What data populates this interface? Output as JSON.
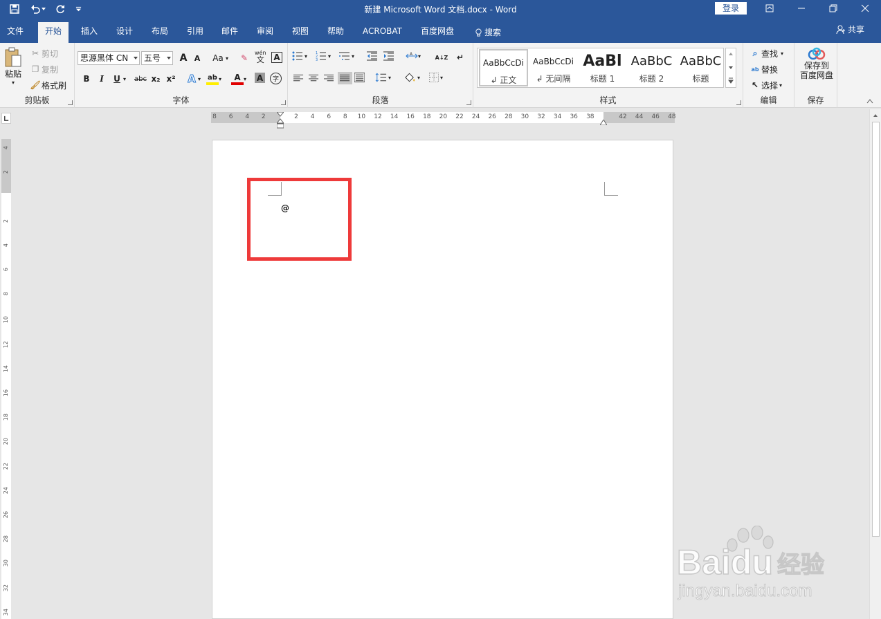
{
  "titlebar": {
    "title": "新建 Microsoft Word 文档.docx  -  Word",
    "login_label": "登录"
  },
  "tabs": [
    "文件",
    "开始",
    "插入",
    "设计",
    "布局",
    "引用",
    "邮件",
    "审阅",
    "视图",
    "帮助",
    "ACROBAT",
    "百度网盘",
    "搜索"
  ],
  "share_label": "共享",
  "clipboard": {
    "paste": "粘贴",
    "cut": "剪切",
    "copy": "复制",
    "format_painter": "格式刷",
    "group": "剪贴板"
  },
  "font": {
    "name": "思源黑体 CN",
    "size": "五号",
    "grow": "A",
    "shrink": "A",
    "case": "Aa",
    "phonetic": "wén",
    "phonetic_sub": "文",
    "border_char": "A",
    "bold": "B",
    "italic": "I",
    "underline": "U",
    "strike": "abc",
    "sub": "x₂",
    "sup": "x²",
    "effects": "A",
    "highlight": "ab",
    "color": "A",
    "shade": "A",
    "enclose": "字",
    "group": "字体"
  },
  "paragraph": {
    "sort": "A↓Z",
    "mark": "↵",
    "group": "段落"
  },
  "styles": {
    "items": [
      {
        "preview": "AaBbCcDi",
        "name": "↲ 正文"
      },
      {
        "preview": "AaBbCcDi",
        "name": "↲ 无间隔"
      },
      {
        "preview": "AaBl",
        "name": "标题 1"
      },
      {
        "preview": "AaBbC",
        "name": "标题 2"
      },
      {
        "preview": "AaBbC",
        "name": "标题"
      }
    ],
    "group": "样式"
  },
  "editing": {
    "find": "查找",
    "replace": "替换",
    "select": "选择",
    "group": "编辑"
  },
  "save": {
    "line1": "保存到",
    "line2": "百度网盘",
    "group": "保存"
  },
  "ruler_top": [
    "8",
    "6",
    "4",
    "2",
    "",
    "2",
    "4",
    "6",
    "8",
    "10",
    "12",
    "14",
    "16",
    "18",
    "20",
    "22",
    "24",
    "26",
    "28",
    "30",
    "32",
    "34",
    "36",
    "38",
    "",
    "42",
    "44",
    "46",
    "48"
  ],
  "ruler_left": [
    "4",
    "2",
    "",
    "2",
    "4",
    "6",
    "8",
    "10",
    "12",
    "14",
    "16",
    "18",
    "20",
    "22",
    "24",
    "26",
    "28",
    "30",
    "32",
    "34"
  ],
  "document": {
    "content": "@"
  },
  "watermark": {
    "brand": "Baidu",
    "brand2": "经验",
    "url": "jingyan.baidu.com"
  },
  "colors": {
    "ribbon_blue": "#2b579a",
    "highlight_red": "#ee3a3a"
  }
}
